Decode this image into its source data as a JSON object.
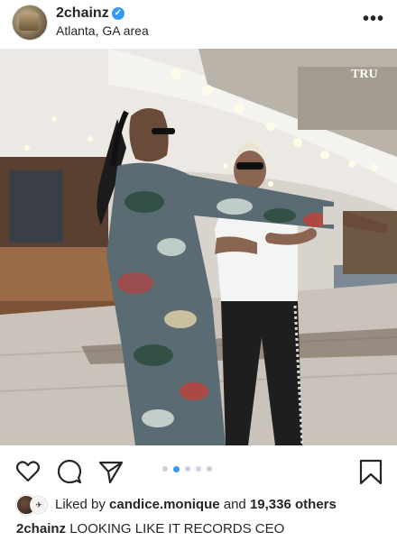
{
  "post": {
    "username": "2chainz",
    "verified_icon": "verified-badge-icon",
    "location": "Atlanta, GA area",
    "more_label": "•••",
    "image_watermark": "TRU",
    "carousel": {
      "count": 5,
      "active_index": 1
    },
    "likes": {
      "prefix": "Liked by",
      "user": "candice.monique",
      "middle": "and",
      "count": "19,336 others"
    },
    "caption": {
      "username": "2chainz",
      "text": "LOOKING LIKE IT RECORDS CEO"
    },
    "icons": [
      "heart-icon",
      "comment-icon",
      "share-icon",
      "bookmark-icon",
      "more-icon"
    ]
  }
}
